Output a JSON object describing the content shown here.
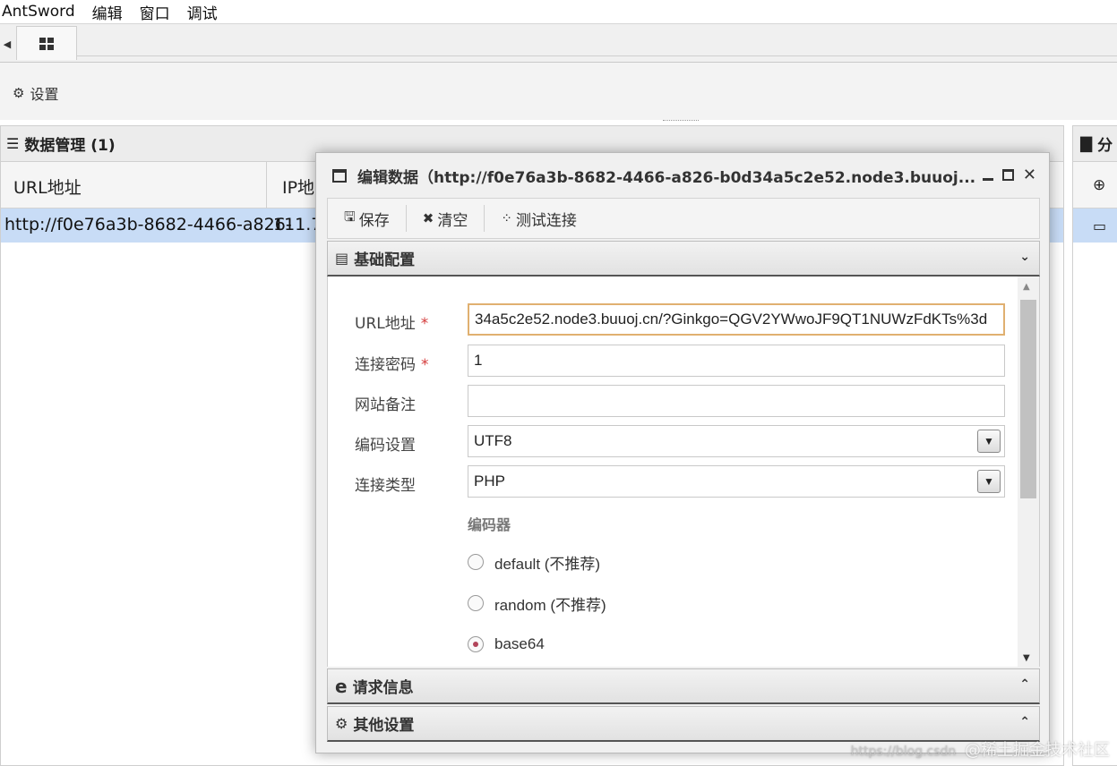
{
  "menu": [
    "AntSword",
    "编辑",
    "窗口",
    "调试"
  ],
  "toolbar": {
    "settings_label": "设置"
  },
  "data_panel": {
    "title": "数据管理 (1)",
    "columns": [
      "URL地址",
      "IP地"
    ],
    "rows": [
      {
        "url": "http://f0e76a3b-8682-4466-a826-",
        "ip": "111.7"
      }
    ]
  },
  "category_panel": {
    "title": "分",
    "add_label": "",
    "row_label": ""
  },
  "dialog": {
    "title": "编辑数据（http://f0e76a3b-8682-4466-a826-b0d34a5c2e52.node3.buuoj...",
    "toolbar": {
      "save": "保存",
      "clear": "清空",
      "test": "测试连接"
    },
    "sections": {
      "basic": "基础配置",
      "request": "请求信息",
      "other": "其他设置"
    },
    "form": {
      "url_label": "URL地址",
      "url_value": "34a5c2e52.node3.buuoj.cn/?Ginkgo=QGV2YWwoJF9QT1NUWzFdKTs%3d",
      "password_label": "连接密码",
      "password_value": "1",
      "note_label": "网站备注",
      "note_value": "",
      "encoding_label": "编码设置",
      "encoding_value": "UTF8",
      "type_label": "连接类型",
      "type_value": "PHP",
      "encoder_label": "编码器",
      "required_mark": "*",
      "encoders": [
        {
          "label": "default (不推荐)",
          "checked": false
        },
        {
          "label": "random (不推荐)",
          "checked": false
        },
        {
          "label": "base64",
          "checked": true
        }
      ]
    }
  },
  "watermark": {
    "url": "https://blog.csdn",
    "text": "@稀土掘金技术社区"
  },
  "colors": {
    "selected_row": "#c8dcf6",
    "required": "#d43a3a",
    "active_border": "#e0b070",
    "radio_dot": "#b2455b"
  }
}
